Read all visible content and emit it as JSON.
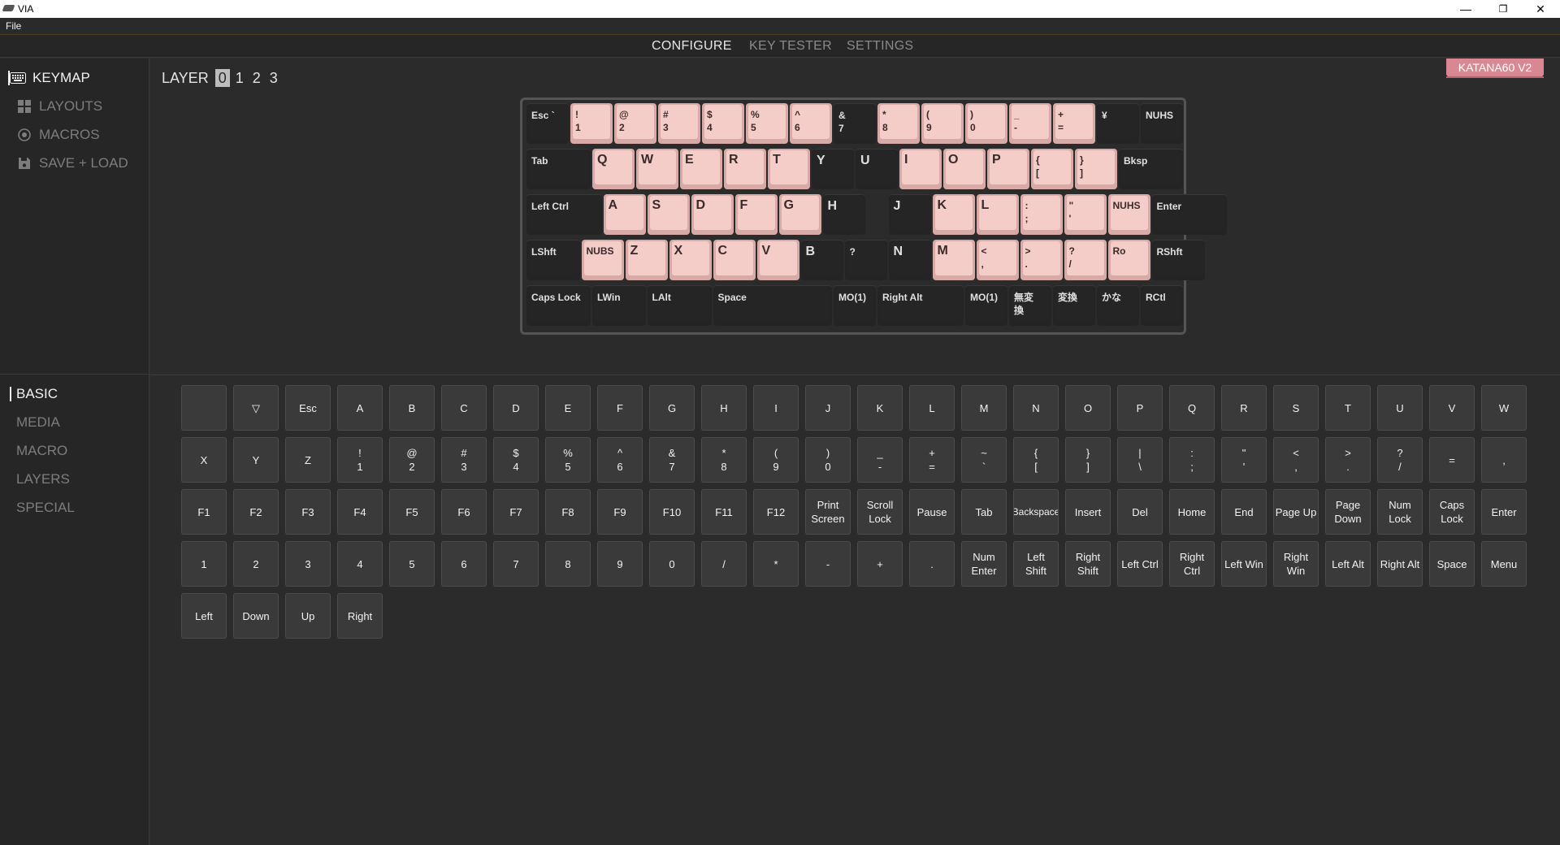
{
  "window": {
    "title": "VIA",
    "minimize": "—",
    "restore": "❐",
    "close": "✕"
  },
  "menu": {
    "file": "File"
  },
  "nav": {
    "tabs": [
      "CONFIGURE",
      "KEY TESTER",
      "SETTINGS"
    ],
    "active": 0
  },
  "sidebar": {
    "items": [
      "KEYMAP",
      "LAYOUTS",
      "MACROS",
      "SAVE + LOAD"
    ],
    "icons": [
      "keyboard-icon",
      "layouts-icon",
      "macros-icon",
      "save-icon"
    ],
    "categories": [
      "BASIC",
      "MEDIA",
      "MACRO",
      "LAYERS",
      "SPECIAL"
    ]
  },
  "layer": {
    "label": "LAYER",
    "numbers": [
      "0",
      "1",
      "2",
      "3"
    ],
    "active": 0
  },
  "device": {
    "name": "KATANA60 V2"
  },
  "colors": {
    "accent": "#d98893",
    "keycap_pink": "#f4ccc8",
    "keycap_dark": "#242424",
    "background": "#2b2b2b"
  },
  "keyboard_rows": [
    [
      "Esc `",
      "!\n1",
      "@\n2",
      "#\n3",
      "$\n4",
      "%\n5",
      "^\n6",
      "&\n7",
      "*\n8",
      "(\n9",
      ")\n0",
      "_\n-",
      "+\n=",
      "¥",
      "NUHS"
    ],
    [
      "Tab",
      "Q",
      "W",
      "E",
      "R",
      "T",
      "Y",
      "U",
      "I",
      "O",
      "P",
      "{\n[",
      "}\n]",
      "Bksp"
    ],
    [
      "Left Ctrl",
      "A",
      "S",
      "D",
      "F",
      "G",
      "H",
      "",
      "J",
      "K",
      "L",
      ":\n;",
      "\"\n'",
      "NUHS",
      "Enter"
    ],
    [
      "LShft",
      "NUBS",
      "Z",
      "X",
      "C",
      "V",
      "B",
      "?",
      "N",
      "M",
      "<\n,",
      ">\n.",
      "?\n/",
      "Ro",
      "RShft"
    ],
    [
      "Caps Lock",
      "LWin",
      "LAlt",
      "Space",
      "MO(1)",
      "Right Alt",
      "MO(1)",
      "無変\n換",
      "変換",
      "かな",
      "RCtl"
    ]
  ],
  "picker_keys": [
    [
      "",
      "▽",
      "Esc",
      "A",
      "B",
      "C",
      "D",
      "E",
      "F",
      "G",
      "H",
      "I",
      "J",
      "K",
      "L",
      "M",
      "N",
      "O",
      "P",
      "Q",
      "R",
      "S",
      "T",
      "U",
      "V",
      "W"
    ],
    [
      "X",
      "Y",
      "Z",
      "!\n1",
      "@\n2",
      "#\n3",
      "$\n4",
      "%\n5",
      "^\n6",
      "&\n7",
      "*\n8",
      "(\n9",
      ")\n0",
      "_\n-",
      "+\n=",
      "~\n`",
      "{\n[",
      "}\n]",
      "|\n\\",
      ":\n;",
      "\"\n'",
      "<\n,",
      ">\n.",
      "?\n/",
      "=",
      ","
    ],
    [
      "F1",
      "F2",
      "F3",
      "F4",
      "F5",
      "F6",
      "F7",
      "F8",
      "F9",
      "F10",
      "F11",
      "F12",
      "Print\nScreen",
      "Scroll\nLock",
      "Pause",
      "Tab",
      "Backspace",
      "Insert",
      "Del",
      "Home",
      "End",
      "Page Up",
      "Page\nDown",
      "Num\nLock",
      "Caps\nLock",
      "Enter"
    ],
    [
      "1",
      "2",
      "3",
      "4",
      "5",
      "6",
      "7",
      "8",
      "9",
      "0",
      "/",
      "*",
      "-",
      "+",
      ".",
      "Num\nEnter",
      "Left\nShift",
      "Right\nShift",
      "Left Ctrl",
      "Right\nCtrl",
      "Left Win",
      "Right\nWin",
      "Left Alt",
      "Right Alt",
      "Space",
      "Menu"
    ],
    [
      "Left",
      "Down",
      "Up",
      "Right"
    ]
  ]
}
